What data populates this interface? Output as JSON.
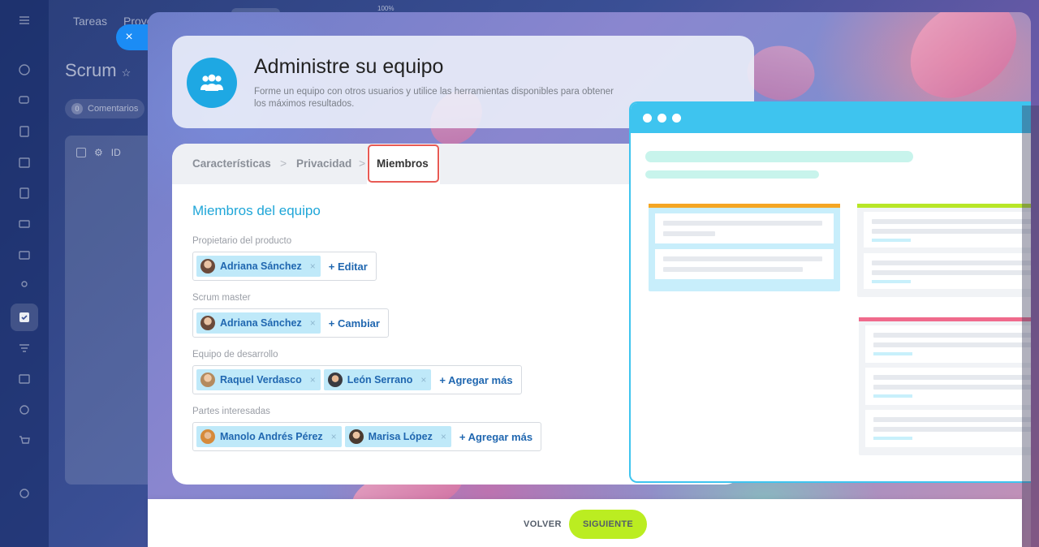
{
  "background": {
    "tabs": [
      "Tareas",
      "Proye"
    ],
    "zoom": "100%",
    "page_title": "Scrum",
    "comments_label": "Comentarios",
    "comments_count": "0",
    "table_id_header": "ID"
  },
  "close_label": "×",
  "header": {
    "title": "Administre su equipo",
    "description": "Forme un equipo con otros usuarios y utilice las herramientas disponibles para obtener los máximos resultados."
  },
  "steps": [
    {
      "label": "Características"
    },
    {
      "label": "Privacidad"
    },
    {
      "label": "Miembros"
    }
  ],
  "step_separator": ">",
  "form": {
    "section_title": "Miembros del equipo",
    "remove_symbol": "×",
    "fields": [
      {
        "label": "Propietario del producto",
        "members": [
          "Adriana Sánchez"
        ],
        "action": "+ Editar"
      },
      {
        "label": "Scrum master",
        "members": [
          "Adriana Sánchez"
        ],
        "action": "+ Cambiar"
      },
      {
        "label": "Equipo de desarrollo",
        "members": [
          "Raquel Verdasco",
          "León Serrano"
        ],
        "action": "+ Agregar más"
      },
      {
        "label": "Partes interesadas",
        "members": [
          "Manolo Andrés Pérez",
          "Marisa López"
        ],
        "action": "+ Agregar más"
      }
    ]
  },
  "footer": {
    "back_label": "VOLVER",
    "next_label": "SIGUIENTE"
  },
  "colors": {
    "accent_blue": "#1fa6d8",
    "link_blue": "#2067b0",
    "tag_bg": "#bfe9f9",
    "next_button": "#bbed21",
    "highlight": "#e85a54",
    "illus_blue": "#3ec4ef",
    "col_orange": "#f5a623",
    "col_green": "#b8e627",
    "col_pink": "#f06a8c"
  }
}
